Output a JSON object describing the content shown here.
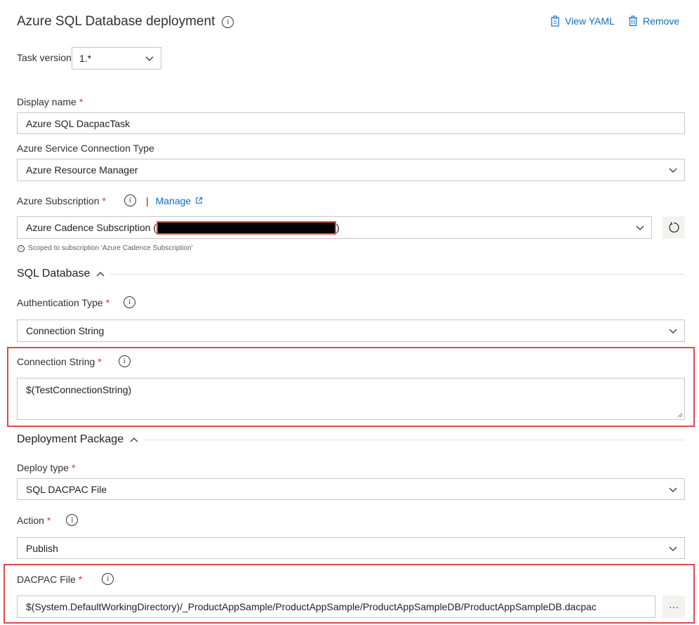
{
  "header": {
    "title": "Azure SQL Database deployment",
    "view_yaml": "View YAML",
    "remove": "Remove"
  },
  "task_version": {
    "label": "Task version",
    "value": "1.*"
  },
  "display_name": {
    "label": "Display name",
    "required": "*",
    "value": "Azure SQL DacpacTask"
  },
  "connection_type": {
    "label": "Azure Service Connection Type",
    "value": "Azure Resource Manager"
  },
  "subscription": {
    "label": "Azure Subscription",
    "required": "*",
    "separator": "|",
    "manage": "Manage",
    "value_prefix": "Azure Cadence Subscription (",
    "value_suffix": ")",
    "note": "Scoped to subscription 'Azure Cadence Subscription'"
  },
  "sql_section": {
    "title": "SQL Database"
  },
  "auth_type": {
    "label": "Authentication Type",
    "required": "*",
    "value": "Connection String"
  },
  "connection_string": {
    "label": "Connection String",
    "required": "*",
    "value": "$(TestConnectionString)"
  },
  "deploy_section": {
    "title": "Deployment Package"
  },
  "deploy_type": {
    "label": "Deploy type",
    "required": "*",
    "value": "SQL DACPAC File"
  },
  "action": {
    "label": "Action",
    "required": "*",
    "value": "Publish"
  },
  "dacpac": {
    "label": "DACPAC File",
    "required": "*",
    "value": "$(System.DefaultWorkingDirectory)/_ProductAppSample/ProductAppSample/ProductAppSampleDB/ProductAppSampleDB.dacpac",
    "browse": "···"
  },
  "colors": {
    "accent": "#106ebe",
    "required": "#d13438",
    "highlight": "#e0484b"
  }
}
